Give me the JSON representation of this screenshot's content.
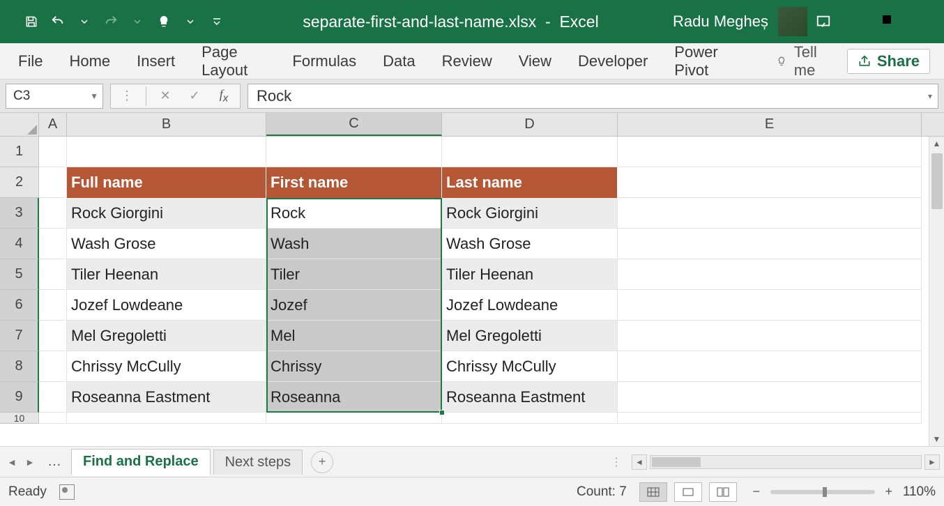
{
  "titlebar": {
    "filename": "separate-first-and-last-name.xlsx",
    "separator": "-",
    "app": "Excel",
    "user": "Radu Megheș"
  },
  "ribbon": {
    "tabs": [
      "File",
      "Home",
      "Insert",
      "Page Layout",
      "Formulas",
      "Data",
      "Review",
      "View",
      "Developer",
      "Power Pivot"
    ],
    "tellme": "Tell me",
    "share": "Share"
  },
  "formula_bar": {
    "name_box": "C3",
    "formula": "Rock"
  },
  "columns": [
    "A",
    "B",
    "C",
    "D",
    "E"
  ],
  "row_numbers": [
    "1",
    "2",
    "3",
    "4",
    "5",
    "6",
    "7",
    "8",
    "9",
    "10"
  ],
  "headers": {
    "B": "Full name",
    "C": "First name",
    "D": "Last name"
  },
  "rows": [
    {
      "B": "Rock Giorgini",
      "C": "Rock",
      "D": "Rock Giorgini"
    },
    {
      "B": "Wash Grose",
      "C": "Wash",
      "D": "Wash Grose"
    },
    {
      "B": "Tiler Heenan",
      "C": "Tiler",
      "D": "Tiler Heenan"
    },
    {
      "B": "Jozef Lowdeane",
      "C": "Jozef",
      "D": "Jozef Lowdeane"
    },
    {
      "B": "Mel Gregoletti",
      "C": "Mel",
      "D": "Mel Gregoletti"
    },
    {
      "B": "Chrissy McCully",
      "C": "Chrissy",
      "D": "Chrissy McCully"
    },
    {
      "B": "Roseanna Eastment",
      "C": "Roseanna",
      "D": "Roseanna Eastment"
    }
  ],
  "sheets": {
    "active": "Find and Replace",
    "other": "Next steps"
  },
  "statusbar": {
    "ready": "Ready",
    "count": "Count: 7",
    "zoom": "110%"
  },
  "selection": {
    "active_cell": "C3",
    "range": "C3:C9"
  }
}
